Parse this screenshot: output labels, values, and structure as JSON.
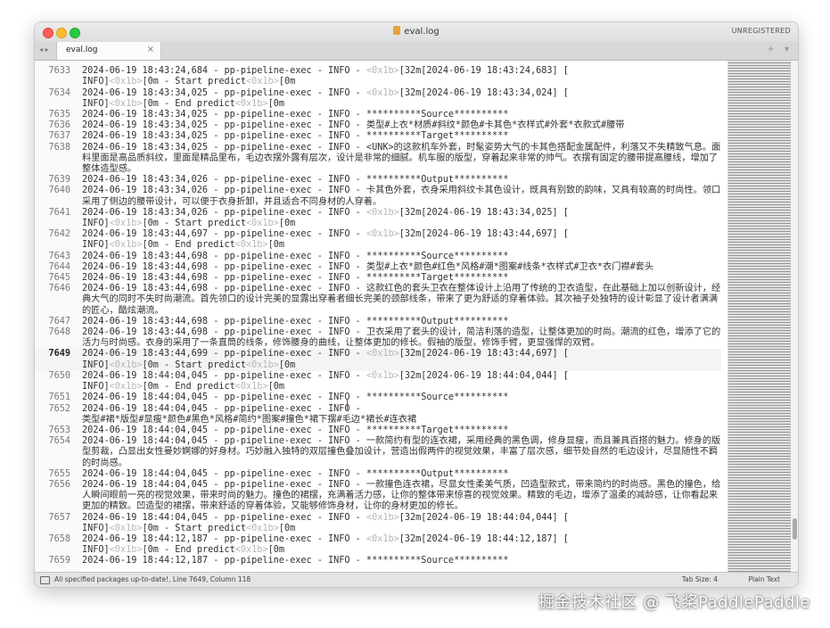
{
  "window": {
    "title": "eval.log",
    "registration": "UNREGISTERED"
  },
  "tabs": [
    {
      "label": "eval.log",
      "close": "×"
    }
  ],
  "tab_tools": "+ ▾",
  "nav_arrows": "◂ ▸",
  "editor": {
    "rows": [
      {
        "n": "",
        "segs": [
          {
            "t": "        "
          }
        ]
      },
      {
        "n": "7633",
        "segs": [
          {
            "t": "2024-06-19 18:43:24,684 - pp-pipeline-exec - INFO - "
          },
          {
            "t": "<0x1b>",
            "c": "esc"
          },
          {
            "t": "[32m[2024-06-19 18:43:24,683] [\nINFO]"
          },
          {
            "t": "<0x1b>",
            "c": "esc"
          },
          {
            "t": "[0m - Start predict"
          },
          {
            "t": "<0x1b>",
            "c": "esc"
          },
          {
            "t": "[0m"
          }
        ]
      },
      {
        "n": "7634",
        "segs": [
          {
            "t": "2024-06-19 18:43:34,025 - pp-pipeline-exec - INFO - "
          },
          {
            "t": "<0x1b>",
            "c": "esc"
          },
          {
            "t": "[32m[2024-06-19 18:43:34,024] [\nINFO]"
          },
          {
            "t": "<0x1b>",
            "c": "esc"
          },
          {
            "t": "[0m - End predict"
          },
          {
            "t": "<0x1b>",
            "c": "esc"
          },
          {
            "t": "[0m"
          }
        ]
      },
      {
        "n": "7635",
        "segs": [
          {
            "t": "2024-06-19 18:43:34,025 - pp-pipeline-exec - INFO - **********Source**********"
          }
        ]
      },
      {
        "n": "7636",
        "segs": [
          {
            "t": "2024-06-19 18:43:34,025 - pp-pipeline-exec - INFO - 类型#上衣*材质#斜纹*颜色#卡其色*衣样式#外套*衣款式#腰带"
          }
        ]
      },
      {
        "n": "7637",
        "segs": [
          {
            "t": "2024-06-19 18:43:34,025 - pp-pipeline-exec - INFO - **********Target**********"
          }
        ]
      },
      {
        "n": "7638",
        "segs": [
          {
            "t": "2024-06-19 18:43:34,025 - pp-pipeline-exec - INFO - <UNK>的这款机车外套，时髦姿势大气的卡其色搭配金属配件，利落又不失精致气息。面料里面是高品质斜纹，里面是精品里布，毛边衣摆外露有层次，设计是非常的细腻。机车服的版型，穿着起来非常的帅气。衣摆有固定的腰带提高腰线，增加了整体造型感。"
          }
        ]
      },
      {
        "n": "7639",
        "segs": [
          {
            "t": "2024-06-19 18:43:34,026 - pp-pipeline-exec - INFO - **********Output**********"
          }
        ]
      },
      {
        "n": "7640",
        "segs": [
          {
            "t": "2024-06-19 18:43:34,026 - pp-pipeline-exec - INFO - 卡其色外套，衣身采用斜纹卡其色设计，既具有别致的韵味，又具有较高的时尚性。领口采用了侧边的腰带设计，可以便于衣身折卸，并且适合不同身材的人穿着。"
          }
        ]
      },
      {
        "n": "7641",
        "segs": [
          {
            "t": "2024-06-19 18:43:34,026 - pp-pipeline-exec - INFO - "
          },
          {
            "t": "<0x1b>",
            "c": "esc"
          },
          {
            "t": "[32m[2024-06-19 18:43:34,025] [\nINFO]"
          },
          {
            "t": "<0x1b>",
            "c": "esc"
          },
          {
            "t": "[0m - Start predict"
          },
          {
            "t": "<0x1b>",
            "c": "esc"
          },
          {
            "t": "[0m"
          }
        ]
      },
      {
        "n": "7642",
        "segs": [
          {
            "t": "2024-06-19 18:43:44,697 - pp-pipeline-exec - INFO - "
          },
          {
            "t": "<0x1b>",
            "c": "esc"
          },
          {
            "t": "[32m[2024-06-19 18:43:44,697] [\nINFO]"
          },
          {
            "t": "<0x1b>",
            "c": "esc"
          },
          {
            "t": "[0m - End predict"
          },
          {
            "t": "<0x1b>",
            "c": "esc"
          },
          {
            "t": "[0m"
          }
        ]
      },
      {
        "n": "7643",
        "segs": [
          {
            "t": "2024-06-19 18:43:44,698 - pp-pipeline-exec - INFO - **********Source**********"
          }
        ]
      },
      {
        "n": "7644",
        "segs": [
          {
            "t": "2024-06-19 18:43:44,698 - pp-pipeline-exec - INFO - 类型#上衣*颜色#红色*风格#潮*图案#线条*衣样式#卫衣*衣门襟#套头"
          }
        ]
      },
      {
        "n": "7645",
        "segs": [
          {
            "t": "2024-06-19 18:43:44,698 - pp-pipeline-exec - INFO - **********Target**********"
          }
        ]
      },
      {
        "n": "7646",
        "segs": [
          {
            "t": "2024-06-19 18:43:44,698 - pp-pipeline-exec - INFO - 这款红色的套头卫衣在整体设计上沿用了传统的卫衣造型，在此基础上加以创新设计，经典大气的同时不失时尚潮流。首先领口的设计完美的显露出穿着者细长完美的颈部线条，带来了更为舒适的穿着体验。其次袖子处独特的设计彰显了设计者满满的匠心，酷炫潮流。"
          }
        ]
      },
      {
        "n": "7647",
        "segs": [
          {
            "t": "2024-06-19 18:43:44,698 - pp-pipeline-exec - INFO - **********Output**********"
          }
        ]
      },
      {
        "n": "7648",
        "segs": [
          {
            "t": "2024-06-19 18:43:44,698 - pp-pipeline-exec - INFO - 卫衣采用了套头的设计，简洁利落的造型，让整体更加的时尚。潮流的红色，增添了它的活力与时尚感。衣身的采用了一条直筒的线条，修饰腰身的曲线，让整体更加的修长。假袖的版型，修饰手臂，更显强悍的双臂。"
          }
        ]
      },
      {
        "n": "7649",
        "current": true,
        "segs": [
          {
            "t": "2024-06-19 18:43:44,699 - pp-pipeline-exec - INFO - "
          },
          {
            "t": "<0x1b>",
            "c": "esc"
          },
          {
            "t": "[32m[2024-06-19 18:43:44,697] [\nINFO]"
          },
          {
            "t": "<0x1b>",
            "c": "esc"
          },
          {
            "t": "[0m - Start predict"
          },
          {
            "t": "<0x1b>",
            "c": "esc"
          },
          {
            "t": "[0m"
          }
        ]
      },
      {
        "n": "7650",
        "segs": [
          {
            "t": "2024-06-19 18:44:04,045 - pp-pipeline-exec - INFO - "
          },
          {
            "t": "<0x1b>",
            "c": "esc"
          },
          {
            "t": "[32m[2024-06-19 18:44:04,044] [\nINFO]"
          },
          {
            "t": "<0x1b>",
            "c": "esc"
          },
          {
            "t": "[0m - End predict"
          },
          {
            "t": "<0x1b>",
            "c": "esc"
          },
          {
            "t": "[0m"
          }
        ]
      },
      {
        "n": "7651",
        "segs": [
          {
            "t": "2024-06-19 18:44:04,045 - pp-pipeline-exec - INFO - **********Source**********"
          }
        ]
      },
      {
        "n": "7652",
        "segs": [
          {
            "t": "2024-06-19 18:44:04,045 - pp-pipeline-exec - INFO -\n类型#裙*版型#显瘦*颜色#黑色*风格#简约*图案#撞色*裙下摆#毛边*裙长#连衣裙"
          }
        ]
      },
      {
        "n": "7653",
        "segs": [
          {
            "t": "2024-06-19 18:44:04,045 - pp-pipeline-exec - INFO - **********Target**********"
          }
        ]
      },
      {
        "n": "7654",
        "segs": [
          {
            "t": "2024-06-19 18:44:04,045 - pp-pipeline-exec - INFO - 一款简约有型的连衣裙，采用经典的黑色调，修身显瘦，而且兼具百搭的魅力。修身的版型剪裁，凸显出女性曼妙婀娜的好身材。巧妙融入独特的双层撞色叠加设计，营造出假两件的视觉效果，丰富了层次感，细节处自然的毛边设计，尽显随性不羁的时尚感。"
          }
        ]
      },
      {
        "n": "7655",
        "segs": [
          {
            "t": "2024-06-19 18:44:04,045 - pp-pipeline-exec - INFO - **********Output**********"
          }
        ]
      },
      {
        "n": "7656",
        "segs": [
          {
            "t": "2024-06-19 18:44:04,045 - pp-pipeline-exec - INFO - 一款撞色连衣裙，尽显女性柔美气质，凹造型款式，带来简约的时尚感。黑色的撞色，给人瞬间眼前一亮的视觉效果，带来时尚的魅力。撞色的裙摆，充满着活力感，让你的整体带来惊喜的视觉效果。精致的毛边，增添了温柔的减龄感，让你看起来更加的精致。凹造型的裙摆，带来舒适的穿着体验，又能够修饰身材，让你的身材更加的修长。"
          }
        ]
      },
      {
        "n": "7657",
        "segs": [
          {
            "t": "2024-06-19 18:44:04,045 - pp-pipeline-exec - INFO - "
          },
          {
            "t": "<0x1b>",
            "c": "esc"
          },
          {
            "t": "[32m[2024-06-19 18:44:04,044] [\nINFO]"
          },
          {
            "t": "<0x1b>",
            "c": "esc"
          },
          {
            "t": "[0m - Start predict"
          },
          {
            "t": "<0x1b>",
            "c": "esc"
          },
          {
            "t": "[0m"
          }
        ]
      },
      {
        "n": "7658",
        "segs": [
          {
            "t": "2024-06-19 18:44:12,187 - pp-pipeline-exec - INFO - "
          },
          {
            "t": "<0x1b>",
            "c": "esc"
          },
          {
            "t": "[32m[2024-06-19 18:44:12,187] [\nINFO]"
          },
          {
            "t": "<0x1b>",
            "c": "esc"
          },
          {
            "t": "[0m - End predict"
          },
          {
            "t": "<0x1b>",
            "c": "esc"
          },
          {
            "t": "[0m"
          }
        ]
      },
      {
        "n": "7659",
        "segs": [
          {
            "t": "2024-06-19 18:44:12,187 - pp-pipeline-exec - INFO - **********Source**********"
          }
        ]
      }
    ]
  },
  "status": {
    "message": "All specified packages up-to-date!, Line 7649, Column 118",
    "tab_size": "Tab Size: 4",
    "syntax": "Plain Text"
  },
  "watermark": "掘金技术社区 @ 飞桨PaddlePaddle",
  "colors": {
    "escape_token": "#b7b7b7",
    "caret": "#b93a2c",
    "close_light": "#ff5f57",
    "minimize_light": "#febc2e",
    "zoom_light": "#28c840"
  }
}
